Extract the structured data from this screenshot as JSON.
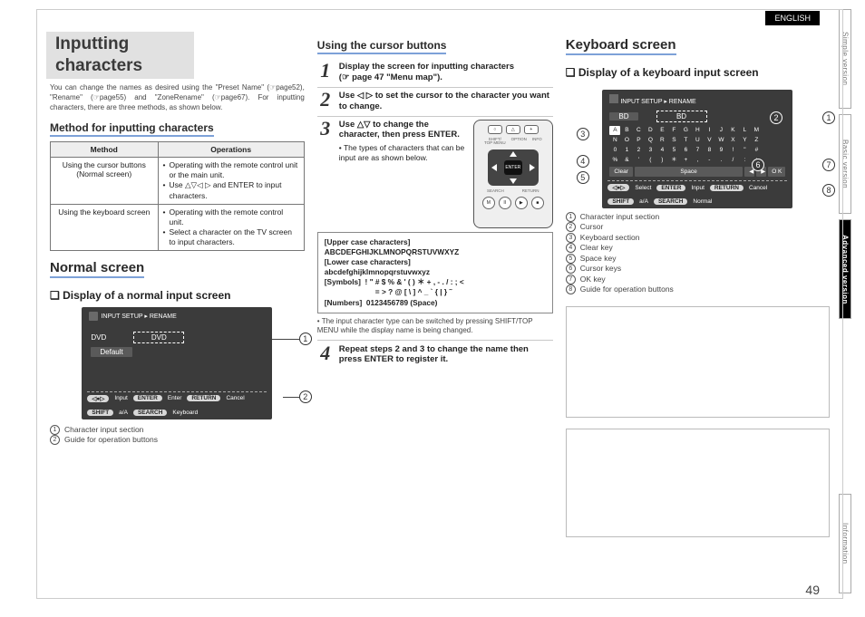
{
  "language_tag": "ENGLISH",
  "page_number": "49",
  "side_tabs": [
    "Simple version",
    "Basic version",
    "Advanced version",
    "Information"
  ],
  "side_active": 2,
  "heading": "Inputting characters",
  "intro": "You can change the names as desired using the \"Preset Name\" (☞page52), \"Rename\" (☞page55) and \"ZoneRename\" (☞page67). For inputting characters, there are three methods, as shown below.",
  "method_heading": "Method for inputting characters",
  "method_table": {
    "headers": [
      "Method",
      "Operations"
    ],
    "rows": [
      {
        "m": "Using the cursor buttons\n(Normal screen)",
        "op": [
          "Operating with the remote control unit or the main unit.",
          "Use △▽◁ ▷ and ENTER to input characters."
        ]
      },
      {
        "m": "Using the keyboard screen",
        "op": [
          "Operating with the remote control unit.",
          "Select a character on the TV screen to input characters."
        ]
      }
    ]
  },
  "normal_heading": "Normal screen",
  "normal_sub": "❏ Display of a normal input screen",
  "normal_panel": {
    "breadcrumb": "INPUT SETUP ▸ RENAME",
    "label": "DVD",
    "value": "DVD",
    "default": "Default",
    "ops": [
      [
        "◁●▷",
        "Input"
      ],
      [
        "ENTER",
        "Enter"
      ],
      [
        "RETURN",
        "Cancel"
      ],
      [
        "SHIFT",
        "a/A"
      ],
      [
        "SEARCH",
        "Keyboard"
      ]
    ]
  },
  "normal_legend": [
    [
      "1",
      "Character input section"
    ],
    [
      "2",
      "Guide for operation buttons"
    ]
  ],
  "cursor_heading": "Using the cursor buttons",
  "steps": [
    {
      "n": "1",
      "t": "Display the screen for inputting characters",
      "s": "(☞ page 47 \"Menu map\")."
    },
    {
      "n": "2",
      "t": "Use ◁ ▷ to set the cursor to the character you want to change.",
      "s": ""
    },
    {
      "n": "3",
      "t": "Use △▽ to change the character, then press ENTER.",
      "s": "The types of characters that can be input are as shown below."
    },
    {
      "n": "4",
      "t": "Repeat steps 2 and 3 to change the name then press ENTER to register it.",
      "s": ""
    }
  ],
  "charbox": {
    "upper_lbl": "[Upper case characters]",
    "upper": "ABCDEFGHIJKLMNOPQRSTUVWXYZ",
    "lower_lbl": "[Lower case characters]",
    "lower": "abcdefghijklmnopqrstuvwxyz",
    "sym_lbl": "[Symbols]",
    "sym1": "! \" # $ % & ' ( ) ＊ + , - . / : ; <",
    "sym2": "= > ? @ [ \\ ] ^ _ ` { | } ˜",
    "num_lbl": "[Numbers]",
    "num": "0123456789 (Space)"
  },
  "note": "The input character type can be switched by pressing SHIFT/TOP MENU while the display name is being changed.",
  "keyboard_heading": "Keyboard screen",
  "keyboard_sub": "❏ Display of a keyboard input screen",
  "kb_panel": {
    "breadcrumb": "INPUT SETUP ▸ RENAME",
    "title_label": "BD",
    "title_value": "BD",
    "rows": [
      [
        "A",
        "B",
        "C",
        "D",
        "E",
        "F",
        "G",
        "H",
        "I",
        "J",
        "K",
        "L",
        "M"
      ],
      [
        "N",
        "O",
        "P",
        "Q",
        "R",
        "S",
        "T",
        "U",
        "V",
        "W",
        "X",
        "Y",
        "Z"
      ],
      [
        "0",
        "1",
        "2",
        "3",
        "4",
        "5",
        "6",
        "7",
        "8",
        "9",
        "!",
        "\"",
        "#"
      ],
      [
        "%",
        "&",
        "'",
        "(",
        ")",
        "＊",
        "+",
        ",",
        "-",
        ".",
        "/",
        ":",
        ";"
      ]
    ],
    "ctrl": {
      "clear": "Clear",
      "space": "Space",
      "left": "◀",
      "right": "▶",
      "ok": "O K"
    },
    "ops": [
      [
        "◁●▷",
        "Select"
      ],
      [
        "ENTER",
        "Input"
      ],
      [
        "RETURN",
        "Cancel"
      ],
      [
        "SHIFT",
        "a/A"
      ],
      [
        "SEARCH",
        "Normal"
      ]
    ]
  },
  "kb_legend": [
    [
      "1",
      "Character input section"
    ],
    [
      "2",
      "Cursor"
    ],
    [
      "3",
      "Keyboard section"
    ],
    [
      "4",
      "Clear key"
    ],
    [
      "5",
      "Space key"
    ],
    [
      "6",
      "Cursor keys"
    ],
    [
      "7",
      "OK key"
    ],
    [
      "8",
      "Guide for operation buttons"
    ]
  ]
}
